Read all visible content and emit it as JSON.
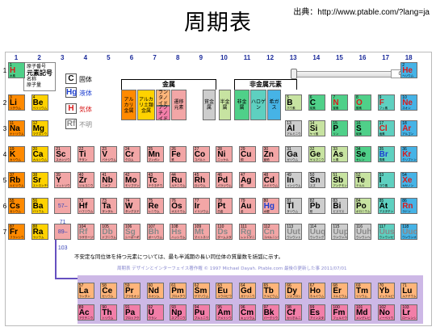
{
  "title": "周期表",
  "source": "出典：http://www.ptable.com/?lang=ja",
  "groups": [
    "1",
    "2",
    "3",
    "4",
    "5",
    "6",
    "7",
    "8",
    "9",
    "10",
    "11",
    "12",
    "13",
    "14",
    "15",
    "16",
    "17",
    "18"
  ],
  "periods": [
    "1",
    "2",
    "3",
    "4",
    "5",
    "6",
    "7"
  ],
  "example_box": {
    "num": "原子番号",
    "sym": "元素記号",
    "name": "名称",
    "mass": "原子量"
  },
  "legend": {
    "states": [
      {
        "sym": "C",
        "label": "固体",
        "state": "solid"
      },
      {
        "sym": "Hg",
        "label": "液体",
        "state": "liquid"
      },
      {
        "sym": "H",
        "label": "気体",
        "state": "gas"
      },
      {
        "sym": "Rf",
        "label": "不明",
        "state": "unknown"
      }
    ],
    "metals_label": "金属",
    "nonmetals_label": "非金属元素",
    "categories": [
      {
        "label": "アルカリ金属",
        "color": "#ff8a00"
      },
      {
        "label": "アルカリ土類金属",
        "color": "#ffd200"
      },
      {
        "label": "ランタノイド",
        "color": "#ffb57a"
      },
      {
        "label": "アクチノイド",
        "color": "#f27ea8"
      },
      {
        "label": "遷移元素",
        "color": "#f2a6a6"
      },
      {
        "label": "貧金属",
        "color": "#cdcdcd"
      },
      {
        "label": "半金属",
        "color": "#c7e3a1"
      },
      {
        "label": "非金属",
        "color": "#4fd089"
      },
      {
        "label": "ハロゲン",
        "color": "#5ed0c0"
      },
      {
        "label": "希ガス",
        "color": "#46b3e6"
      }
    ]
  },
  "slider_value": "0",
  "placeholders": [
    {
      "text": "57–71",
      "row": 6,
      "color": "#f2a6a6"
    },
    {
      "text": "89–103",
      "row": 7,
      "color": "#f2a6a6"
    }
  ],
  "note": "不安定な同位体を持つ元素については、最も半減期の長い同位体の質量数を括弧に示す。",
  "credit": "周期表 デザインとインターフェイス著作権 © 1997 Michael Dayah. Ptable.com 最後の更新した事 2011/07/01",
  "elements": [
    {
      "n": "1",
      "s": "H",
      "jp": "水素",
      "r": 1,
      "c": 1,
      "cat": "nonmetal",
      "st": "gas"
    },
    {
      "n": "2",
      "s": "He",
      "jp": "ヘリウム",
      "r": 1,
      "c": 18,
      "cat": "noble",
      "st": "gas"
    },
    {
      "n": "3",
      "s": "Li",
      "jp": "リチウム",
      "r": 2,
      "c": 1,
      "cat": "alkali",
      "st": "solid"
    },
    {
      "n": "4",
      "s": "Be",
      "jp": "ベリリウム",
      "r": 2,
      "c": 2,
      "cat": "alkaline",
      "st": "solid"
    },
    {
      "n": "5",
      "s": "B",
      "jp": "ホウ素",
      "r": 2,
      "c": 13,
      "cat": "metalloid",
      "st": "solid"
    },
    {
      "n": "6",
      "s": "C",
      "jp": "炭素",
      "r": 2,
      "c": 14,
      "cat": "nonmetal",
      "st": "solid"
    },
    {
      "n": "7",
      "s": "N",
      "jp": "窒素",
      "r": 2,
      "c": 15,
      "cat": "nonmetal",
      "st": "gas"
    },
    {
      "n": "8",
      "s": "O",
      "jp": "酸素",
      "r": 2,
      "c": 16,
      "cat": "nonmetal",
      "st": "gas"
    },
    {
      "n": "9",
      "s": "F",
      "jp": "フッ素",
      "r": 2,
      "c": 17,
      "cat": "halogen",
      "st": "gas"
    },
    {
      "n": "10",
      "s": "Ne",
      "jp": "ネオン",
      "r": 2,
      "c": 18,
      "cat": "noble",
      "st": "gas"
    },
    {
      "n": "11",
      "s": "Na",
      "jp": "ナトリウム",
      "r": 3,
      "c": 1,
      "cat": "alkali",
      "st": "solid"
    },
    {
      "n": "12",
      "s": "Mg",
      "jp": "マグネシウム",
      "r": 3,
      "c": 2,
      "cat": "alkaline",
      "st": "solid"
    },
    {
      "n": "13",
      "s": "Al",
      "jp": "アルミニウム",
      "r": 3,
      "c": 13,
      "cat": "poor",
      "st": "solid"
    },
    {
      "n": "14",
      "s": "Si",
      "jp": "ケイ素",
      "r": 3,
      "c": 14,
      "cat": "metalloid",
      "st": "solid"
    },
    {
      "n": "15",
      "s": "P",
      "jp": "リン",
      "r": 3,
      "c": 15,
      "cat": "nonmetal",
      "st": "solid"
    },
    {
      "n": "16",
      "s": "S",
      "jp": "硫黄",
      "r": 3,
      "c": 16,
      "cat": "nonmetal",
      "st": "solid"
    },
    {
      "n": "17",
      "s": "Cl",
      "jp": "塩素",
      "r": 3,
      "c": 17,
      "cat": "halogen",
      "st": "gas"
    },
    {
      "n": "18",
      "s": "Ar",
      "jp": "アルゴン",
      "r": 3,
      "c": 18,
      "cat": "noble",
      "st": "gas"
    },
    {
      "n": "19",
      "s": "K",
      "jp": "カリウム",
      "r": 4,
      "c": 1,
      "cat": "alkali",
      "st": "solid"
    },
    {
      "n": "20",
      "s": "Ca",
      "jp": "カルシウム",
      "r": 4,
      "c": 2,
      "cat": "alkaline",
      "st": "solid"
    },
    {
      "n": "21",
      "s": "Sc",
      "jp": "スカンジウム",
      "r": 4,
      "c": 3,
      "cat": "transition",
      "st": "solid"
    },
    {
      "n": "22",
      "s": "Ti",
      "jp": "チタン",
      "r": 4,
      "c": 4,
      "cat": "transition",
      "st": "solid"
    },
    {
      "n": "23",
      "s": "V",
      "jp": "バナジウム",
      "r": 4,
      "c": 5,
      "cat": "transition",
      "st": "solid"
    },
    {
      "n": "24",
      "s": "Cr",
      "jp": "クロム",
      "r": 4,
      "c": 6,
      "cat": "transition",
      "st": "solid"
    },
    {
      "n": "25",
      "s": "Mn",
      "jp": "マンガン",
      "r": 4,
      "c": 7,
      "cat": "transition",
      "st": "solid"
    },
    {
      "n": "26",
      "s": "Fe",
      "jp": "鉄",
      "r": 4,
      "c": 8,
      "cat": "transition",
      "st": "solid"
    },
    {
      "n": "27",
      "s": "Co",
      "jp": "コバルト",
      "r": 4,
      "c": 9,
      "cat": "transition",
      "st": "solid"
    },
    {
      "n": "28",
      "s": "Ni",
      "jp": "ニッケル",
      "r": 4,
      "c": 10,
      "cat": "transition",
      "st": "solid"
    },
    {
      "n": "29",
      "s": "Cu",
      "jp": "銅",
      "r": 4,
      "c": 11,
      "cat": "transition",
      "st": "solid"
    },
    {
      "n": "30",
      "s": "Zn",
      "jp": "亜鉛",
      "r": 4,
      "c": 12,
      "cat": "transition",
      "st": "solid"
    },
    {
      "n": "31",
      "s": "Ga",
      "jp": "ガリウム",
      "r": 4,
      "c": 13,
      "cat": "poor",
      "st": "solid"
    },
    {
      "n": "32",
      "s": "Ge",
      "jp": "ゲルマニウム",
      "r": 4,
      "c": 14,
      "cat": "metalloid",
      "st": "solid"
    },
    {
      "n": "33",
      "s": "As",
      "jp": "ヒ素",
      "r": 4,
      "c": 15,
      "cat": "metalloid",
      "st": "solid"
    },
    {
      "n": "34",
      "s": "Se",
      "jp": "セレン",
      "r": 4,
      "c": 16,
      "cat": "nonmetal",
      "st": "solid"
    },
    {
      "n": "35",
      "s": "Br",
      "jp": "臭素",
      "r": 4,
      "c": 17,
      "cat": "halogen",
      "st": "liquid"
    },
    {
      "n": "36",
      "s": "Kr",
      "jp": "クリプトン",
      "r": 4,
      "c": 18,
      "cat": "noble",
      "st": "gas"
    },
    {
      "n": "37",
      "s": "Rb",
      "jp": "ルビジウム",
      "r": 5,
      "c": 1,
      "cat": "alkali",
      "st": "solid"
    },
    {
      "n": "38",
      "s": "Sr",
      "jp": "ストロンチウム",
      "r": 5,
      "c": 2,
      "cat": "alkaline",
      "st": "solid"
    },
    {
      "n": "39",
      "s": "Y",
      "jp": "イットリウム",
      "r": 5,
      "c": 3,
      "cat": "transition",
      "st": "solid"
    },
    {
      "n": "40",
      "s": "Zr",
      "jp": "ジルコニウム",
      "r": 5,
      "c": 4,
      "cat": "transition",
      "st": "solid"
    },
    {
      "n": "41",
      "s": "Nb",
      "jp": "ニオブ",
      "r": 5,
      "c": 5,
      "cat": "transition",
      "st": "solid"
    },
    {
      "n": "42",
      "s": "Mo",
      "jp": "モリブデン",
      "r": 5,
      "c": 6,
      "cat": "transition",
      "st": "solid"
    },
    {
      "n": "43",
      "s": "Tc",
      "jp": "テクネチウム",
      "r": 5,
      "c": 7,
      "cat": "transition",
      "st": "solid"
    },
    {
      "n": "44",
      "s": "Ru",
      "jp": "ルテニウム",
      "r": 5,
      "c": 8,
      "cat": "transition",
      "st": "solid"
    },
    {
      "n": "45",
      "s": "Rh",
      "jp": "ロジウム",
      "r": 5,
      "c": 9,
      "cat": "transition",
      "st": "solid"
    },
    {
      "n": "46",
      "s": "Pd",
      "jp": "パラジウム",
      "r": 5,
      "c": 10,
      "cat": "transition",
      "st": "solid"
    },
    {
      "n": "47",
      "s": "Ag",
      "jp": "銀",
      "r": 5,
      "c": 11,
      "cat": "transition",
      "st": "solid"
    },
    {
      "n": "48",
      "s": "Cd",
      "jp": "カドミウム",
      "r": 5,
      "c": 12,
      "cat": "transition",
      "st": "solid"
    },
    {
      "n": "49",
      "s": "In",
      "jp": "インジウム",
      "r": 5,
      "c": 13,
      "cat": "poor",
      "st": "solid"
    },
    {
      "n": "50",
      "s": "Sn",
      "jp": "スズ",
      "r": 5,
      "c": 14,
      "cat": "poor",
      "st": "solid"
    },
    {
      "n": "51",
      "s": "Sb",
      "jp": "アンチモン",
      "r": 5,
      "c": 15,
      "cat": "metalloid",
      "st": "solid"
    },
    {
      "n": "52",
      "s": "Te",
      "jp": "テルル",
      "r": 5,
      "c": 16,
      "cat": "metalloid",
      "st": "solid"
    },
    {
      "n": "53",
      "s": "I",
      "jp": "ヨウ素",
      "r": 5,
      "c": 17,
      "cat": "halogen",
      "st": "solid"
    },
    {
      "n": "54",
      "s": "Xe",
      "jp": "キセノン",
      "r": 5,
      "c": 18,
      "cat": "noble",
      "st": "gas"
    },
    {
      "n": "55",
      "s": "Cs",
      "jp": "セシウム",
      "r": 6,
      "c": 1,
      "cat": "alkali",
      "st": "solid"
    },
    {
      "n": "56",
      "s": "Ba",
      "jp": "バリウム",
      "r": 6,
      "c": 2,
      "cat": "alkaline",
      "st": "solid"
    },
    {
      "n": "72",
      "s": "Hf",
      "jp": "ハフニウム",
      "r": 6,
      "c": 4,
      "cat": "transition",
      "st": "solid"
    },
    {
      "n": "73",
      "s": "Ta",
      "jp": "タンタル",
      "r": 6,
      "c": 5,
      "cat": "transition",
      "st": "solid"
    },
    {
      "n": "74",
      "s": "W",
      "jp": "タングステン",
      "r": 6,
      "c": 6,
      "cat": "transition",
      "st": "solid"
    },
    {
      "n": "75",
      "s": "Re",
      "jp": "レニウム",
      "r": 6,
      "c": 7,
      "cat": "transition",
      "st": "solid"
    },
    {
      "n": "76",
      "s": "Os",
      "jp": "オスミウム",
      "r": 6,
      "c": 8,
      "cat": "transition",
      "st": "solid"
    },
    {
      "n": "77",
      "s": "Ir",
      "jp": "イリジウム",
      "r": 6,
      "c": 9,
      "cat": "transition",
      "st": "solid"
    },
    {
      "n": "78",
      "s": "Pt",
      "jp": "白金",
      "r": 6,
      "c": 10,
      "cat": "transition",
      "st": "solid"
    },
    {
      "n": "79",
      "s": "Au",
      "jp": "金",
      "r": 6,
      "c": 11,
      "cat": "transition",
      "st": "solid"
    },
    {
      "n": "80",
      "s": "Hg",
      "jp": "水銀",
      "r": 6,
      "c": 12,
      "cat": "transition",
      "st": "liquid"
    },
    {
      "n": "81",
      "s": "Tl",
      "jp": "タリウム",
      "r": 6,
      "c": 13,
      "cat": "poor",
      "st": "solid"
    },
    {
      "n": "82",
      "s": "Pb",
      "jb": "",
      "jp": "鉛",
      "r": 6,
      "c": 14,
      "cat": "poor",
      "st": "solid"
    },
    {
      "n": "83",
      "s": "Bi",
      "jp": "ビスマス",
      "r": 6,
      "c": 15,
      "cat": "poor",
      "st": "solid"
    },
    {
      "n": "84",
      "s": "Po",
      "jp": "ポロニウム",
      "r": 6,
      "c": 16,
      "cat": "metalloid",
      "st": "solid"
    },
    {
      "n": "85",
      "s": "At",
      "jp": "アスタチン",
      "r": 6,
      "c": 17,
      "cat": "halogen",
      "st": "solid"
    },
    {
      "n": "86",
      "s": "Rn",
      "jp": "ラドン",
      "r": 6,
      "c": 18,
      "cat": "noble",
      "st": "gas"
    },
    {
      "n": "87",
      "s": "Fr",
      "jp": "フランシウム",
      "r": 7,
      "c": 1,
      "cat": "alkali",
      "st": "solid"
    },
    {
      "n": "88",
      "s": "Ra",
      "jp": "ラジウム",
      "r": 7,
      "c": 2,
      "cat": "alkaline",
      "st": "solid"
    },
    {
      "n": "104",
      "s": "Rf",
      "jp": "ラザホージウム",
      "r": 7,
      "c": 4,
      "cat": "transition",
      "st": "unknown"
    },
    {
      "n": "105",
      "s": "Db",
      "jp": "ドブニウム",
      "r": 7,
      "c": 5,
      "cat": "transition",
      "st": "unknown"
    },
    {
      "n": "106",
      "s": "Sg",
      "jp": "シーボーギウム",
      "r": 7,
      "c": 6,
      "cat": "transition",
      "st": "unknown"
    },
    {
      "n": "107",
      "s": "Bh",
      "jp": "ボーリウム",
      "r": 7,
      "c": 7,
      "cat": "transition",
      "st": "unknown"
    },
    {
      "n": "108",
      "s": "Hs",
      "jp": "ハッシウム",
      "r": 7,
      "c": 8,
      "cat": "transition",
      "st": "unknown"
    },
    {
      "n": "109",
      "s": "Mt",
      "jp": "マイトネリウム",
      "r": 7,
      "c": 9,
      "cat": "transition",
      "st": "unknown"
    },
    {
      "n": "110",
      "s": "Ds",
      "jp": "ダームスタチウム",
      "r": 7,
      "c": 10,
      "cat": "transition",
      "st": "unknown"
    },
    {
      "n": "111",
      "s": "Rg",
      "jp": "レントゲニウム",
      "r": 7,
      "c": 11,
      "cat": "transition",
      "st": "unknown"
    },
    {
      "n": "112",
      "s": "Cn",
      "jp": "コペルニシウム",
      "r": 7,
      "c": 12,
      "cat": "transition",
      "st": "unknown"
    },
    {
      "n": "113",
      "s": "Uut",
      "jp": "ウンウントリウム",
      "r": 7,
      "c": 13,
      "cat": "poor",
      "st": "unknown"
    },
    {
      "n": "114",
      "s": "Uuq",
      "jp": "ウンウンクアジウム",
      "r": 7,
      "c": 14,
      "cat": "poor",
      "st": "unknown"
    },
    {
      "n": "115",
      "s": "Uup",
      "jp": "ウンウンペンチウム",
      "r": 7,
      "c": 15,
      "cat": "poor",
      "st": "unknown"
    },
    {
      "n": "116",
      "s": "Uuh",
      "jp": "ウンウンヘキシウム",
      "r": 7,
      "c": 16,
      "cat": "poor",
      "st": "unknown"
    },
    {
      "n": "117",
      "s": "Uus",
      "jp": "ウンウンセプチウム",
      "r": 7,
      "c": 17,
      "cat": "halogen",
      "st": "unknown"
    },
    {
      "n": "118",
      "s": "Uuo",
      "jp": "ウンウンオクチウム",
      "r": 7,
      "c": 18,
      "cat": "noble",
      "st": "unknown"
    },
    {
      "n": "57",
      "s": "La",
      "jp": "ランタン",
      "r": 9,
      "c": 4,
      "cat": "lanthanoid",
      "st": "solid"
    },
    {
      "n": "58",
      "s": "Ce",
      "jp": "セリウム",
      "r": 9,
      "c": 5,
      "cat": "lanthanoid",
      "st": "solid"
    },
    {
      "n": "59",
      "s": "Pr",
      "jp": "プラセオジム",
      "r": 9,
      "c": 6,
      "cat": "lanthanoid",
      "st": "solid"
    },
    {
      "n": "60",
      "s": "Nd",
      "jp": "ネオジム",
      "r": 9,
      "c": 7,
      "cat": "lanthanoid",
      "st": "solid"
    },
    {
      "n": "61",
      "s": "Pm",
      "jp": "プロメチウム",
      "r": 9,
      "c": 8,
      "cat": "lanthanoid",
      "st": "solid"
    },
    {
      "n": "62",
      "s": "Sm",
      "jp": "サマリウム",
      "r": 9,
      "c": 9,
      "cat": "lanthanoid",
      "st": "solid"
    },
    {
      "n": "63",
      "s": "Eu",
      "jp": "ユウロピウム",
      "r": 9,
      "c": 10,
      "cat": "lanthanoid",
      "st": "solid"
    },
    {
      "n": "64",
      "s": "Gd",
      "jp": "ガドリニウム",
      "r": 9,
      "c": 11,
      "cat": "lanthanoid",
      "st": "solid"
    },
    {
      "n": "65",
      "s": "Tb",
      "jp": "テルビウム",
      "r": 9,
      "c": 12,
      "cat": "lanthanoid",
      "st": "solid"
    },
    {
      "n": "66",
      "s": "Dy",
      "jp": "ジスプロシウム",
      "r": 9,
      "c": 13,
      "cat": "lanthanoid",
      "st": "solid"
    },
    {
      "n": "67",
      "s": "Ho",
      "jp": "ホルミウム",
      "r": 9,
      "c": 14,
      "cat": "lanthanoid",
      "st": "solid"
    },
    {
      "n": "68",
      "s": "Er",
      "jp": "エルビウム",
      "r": 9,
      "c": 15,
      "cat": "lanthanoid",
      "st": "solid"
    },
    {
      "n": "69",
      "s": "Tm",
      "jp": "ツリウム",
      "r": 9,
      "c": 16,
      "cat": "lanthanoid",
      "st": "solid"
    },
    {
      "n": "70",
      "s": "Yb",
      "jp": "イッテルビウム",
      "r": 9,
      "c": 17,
      "cat": "lanthanoid",
      "st": "solid"
    },
    {
      "n": "71",
      "s": "Lu",
      "jp": "ルテチウム",
      "r": 9,
      "c": 18,
      "cat": "lanthanoid",
      "st": "solid"
    },
    {
      "n": "89",
      "s": "Ac",
      "jp": "アクチニウム",
      "r": 10,
      "c": 4,
      "cat": "actinoid",
      "st": "solid"
    },
    {
      "n": "90",
      "s": "Th",
      "jp": "トリウム",
      "r": 10,
      "c": 5,
      "cat": "actinoid",
      "st": "solid"
    },
    {
      "n": "91",
      "s": "Pa",
      "jp": "プロトアクチニウム",
      "r": 10,
      "c": 6,
      "cat": "actinoid",
      "st": "solid"
    },
    {
      "n": "92",
      "s": "U",
      "jp": "ウラン",
      "r": 10,
      "c": 7,
      "cat": "actinoid",
      "st": "solid"
    },
    {
      "n": "93",
      "s": "Np",
      "jp": "ネプツニウム",
      "r": 10,
      "c": 8,
      "cat": "actinoid",
      "st": "solid"
    },
    {
      "n": "94",
      "s": "Pu",
      "jp": "プルトニウム",
      "r": 10,
      "c": 9,
      "cat": "actinoid",
      "st": "solid"
    },
    {
      "n": "95",
      "s": "Am",
      "jp": "アメリシウム",
      "r": 10,
      "c": 10,
      "cat": "actinoid",
      "st": "solid"
    },
    {
      "n": "96",
      "s": "Cm",
      "jp": "キュリウム",
      "r": 10,
      "c": 11,
      "cat": "actinoid",
      "st": "solid"
    },
    {
      "n": "97",
      "s": "Bk",
      "jp": "バークリウム",
      "r": 10,
      "c": 12,
      "cat": "actinoid",
      "st": "solid"
    },
    {
      "n": "98",
      "s": "Cf",
      "jp": "カリホルニウム",
      "r": 10,
      "c": 13,
      "cat": "actinoid",
      "st": "solid"
    },
    {
      "n": "99",
      "s": "Es",
      "jp": "アインスタイニウム",
      "r": 10,
      "c": 14,
      "cat": "actinoid",
      "st": "solid"
    },
    {
      "n": "100",
      "s": "Fm",
      "jp": "フェルミウム",
      "r": 10,
      "c": 15,
      "cat": "actinoid",
      "st": "solid"
    },
    {
      "n": "101",
      "s": "Md",
      "jp": "メンデレビウム",
      "r": 10,
      "c": 16,
      "cat": "actinoid",
      "st": "solid"
    },
    {
      "n": "102",
      "s": "No",
      "jp": "ノーベリウム",
      "r": 10,
      "c": 17,
      "cat": "actinoid",
      "st": "solid"
    },
    {
      "n": "103",
      "s": "Lr",
      "jp": "ローレンシウム",
      "r": 10,
      "c": 18,
      "cat": "actinoid",
      "st": "solid"
    }
  ],
  "category_colors": {
    "alkali": "#ff8a00",
    "alkaline": "#ffd200",
    "transition": "#f2a6a6",
    "poor": "#cdcdcd",
    "metalloid": "#c7e3a1",
    "nonmetal": "#4fd089",
    "halogen": "#5ed0c0",
    "noble": "#46b3e6",
    "lanthanoid": "#ffb57a",
    "actinoid": "#f27ea8"
  }
}
